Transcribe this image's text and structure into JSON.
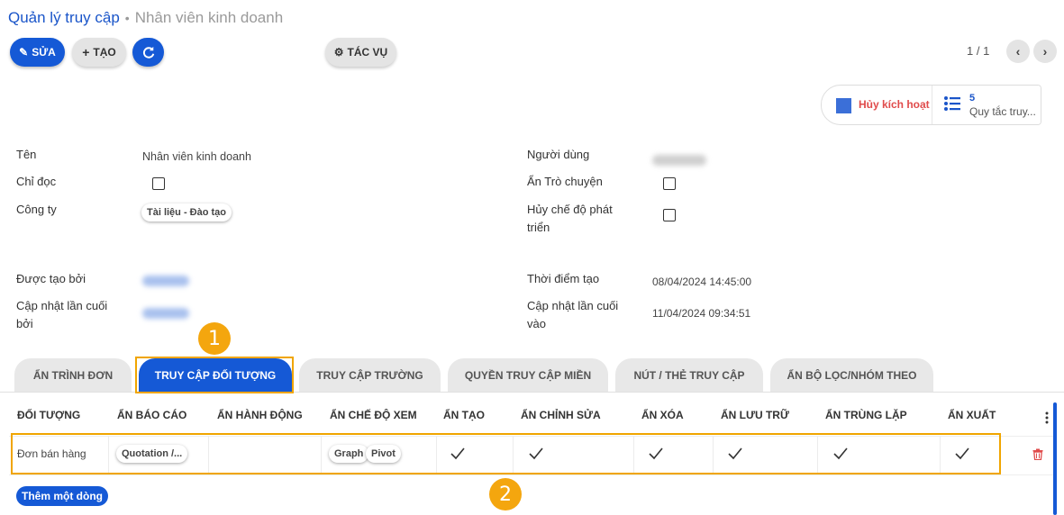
{
  "breadcrumb": {
    "parent": "Quản lý truy cập",
    "current": "Nhân viên kinh doanh"
  },
  "toolbar": {
    "edit": "SỬA",
    "create": "TẠO",
    "actions": "TÁC VỤ",
    "pager": "1 / 1"
  },
  "smart_buttons": {
    "deactivate": "Hủy kích hoạt",
    "rules_count": "5",
    "rules_label": "Quy tắc truy..."
  },
  "fields": {
    "name_label": "Tên",
    "name_value": "Nhân viên kinh doanh",
    "readonly_label": "Chỉ đọc",
    "company_label": "Công ty",
    "company_tag": "Tài liệu - Đào tạo",
    "users_label": "Người dùng",
    "hide_chat_label": "Ẩn Trò chuyện",
    "disable_dev_label_1": "Hủy chế độ phát",
    "disable_dev_label_2": "triển",
    "created_by_label": "Được tạo bởi",
    "updated_by_label_1": "Cập nhật lần cuối",
    "updated_by_label_2": "bởi",
    "created_at_label": "Thời điểm tạo",
    "created_at_value": "08/04/2024 14:45:00",
    "updated_at_label_1": "Cập nhật lần cuối",
    "updated_at_label_2": "vào",
    "updated_at_value": "11/04/2024 09:34:51"
  },
  "tabs": [
    "ẨN TRÌNH ĐƠN",
    "TRUY CẬP ĐỐI TƯỢNG",
    "TRUY CẬP TRƯỜNG",
    "QUYỀN TRUY CẬP MIỀN",
    "NÚT / THẺ TRUY CẬP",
    "ẨN BỘ LỌC/NHÓM THEO"
  ],
  "active_tab": "TRUY CẬP ĐỐI TƯỢNG",
  "table": {
    "headers": [
      "ĐỐI TƯỢNG",
      "ẨN BÁO CÁO",
      "ẨN HÀNH ĐỘNG",
      "ẨN CHẾ ĐỘ XEM",
      "ẨN TẠO",
      "ẨN CHỈNH SỬA",
      "ẨN XÓA",
      "ẨN LƯU TRỮ",
      "ẨN TRÙNG LẶP",
      "ẨN XUẤT"
    ],
    "row": {
      "object": "Đơn bán hàng",
      "report_tag": "Quotation /...",
      "view_tags": [
        "Graph",
        "Pivot"
      ],
      "checks": [
        true,
        true,
        true,
        true,
        true,
        true
      ]
    },
    "add_line": "Thêm một dòng"
  },
  "annotations": [
    "1",
    "2"
  ],
  "colors": {
    "primary": "#1559d6",
    "highlight": "#f0a500",
    "badge": "#f4a60e",
    "danger": "#e04b4b"
  }
}
